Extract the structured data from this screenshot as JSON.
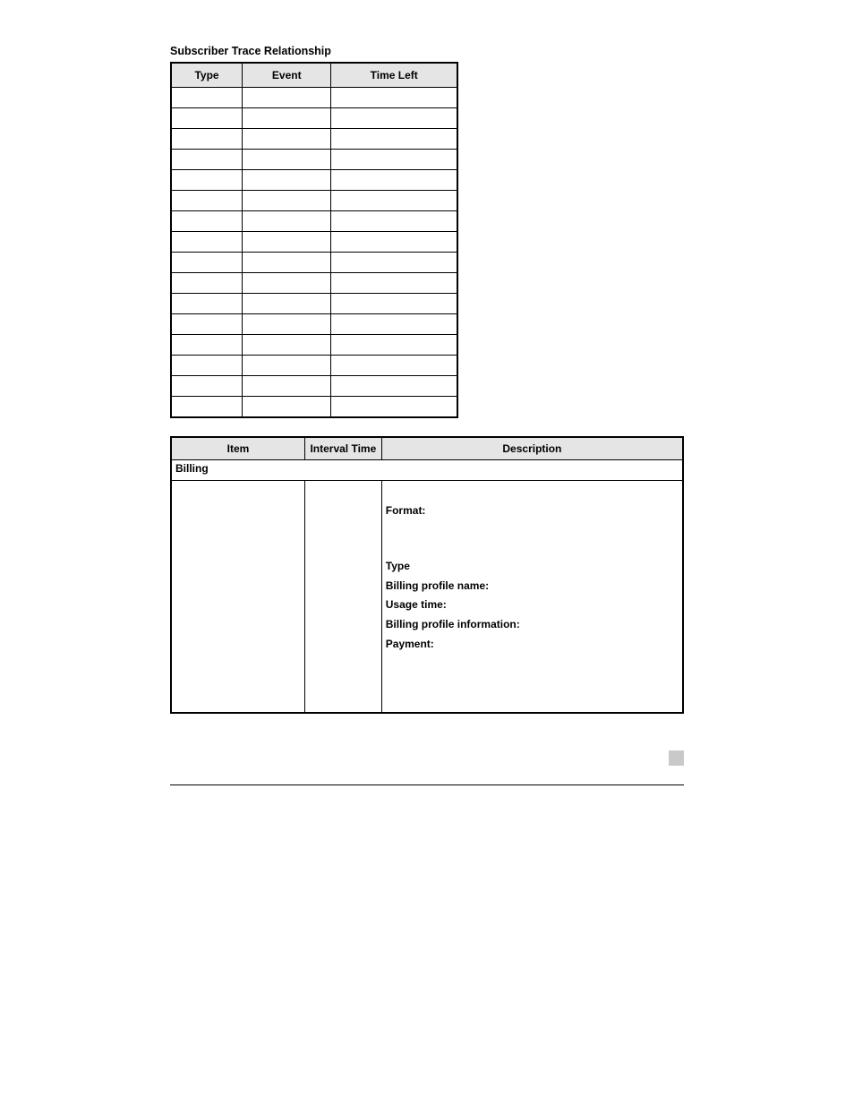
{
  "t1": {
    "caption": "Subscriber Trace Relationship",
    "headers": [
      "Type",
      "Event",
      "Time Left"
    ],
    "rows": [
      [
        "",
        "",
        ""
      ],
      [
        "",
        "",
        ""
      ],
      [
        "",
        "",
        ""
      ],
      [
        "",
        "",
        ""
      ],
      [
        "",
        "",
        ""
      ],
      [
        "",
        "",
        ""
      ],
      [
        "",
        "",
        ""
      ],
      [
        "",
        "",
        ""
      ],
      [
        "",
        "",
        ""
      ],
      [
        "",
        "",
        ""
      ],
      [
        "",
        "",
        ""
      ],
      [
        "",
        "",
        ""
      ],
      [
        "",
        "",
        ""
      ],
      [
        "",
        "",
        ""
      ],
      [
        "",
        "",
        ""
      ],
      [
        "",
        "",
        ""
      ]
    ]
  },
  "t2": {
    "headers": [
      "Item",
      "Interval Time",
      "Description"
    ],
    "section": "Billing",
    "row": {
      "item": "",
      "interval": "",
      "desc": {
        "format_label": "Format:",
        "type_label": "Type",
        "bpn_label": "Billing profile name:",
        "usage_label": "Usage time:",
        "bpi_label": "Billing profile information:",
        "pay_label": "Payment:"
      }
    }
  },
  "footer": {
    "left": "",
    "right": ""
  }
}
